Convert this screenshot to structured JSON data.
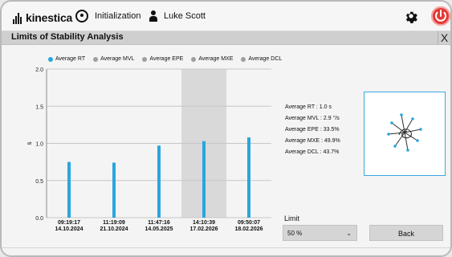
{
  "header": {
    "brand": "kinestica",
    "nav_init_label": "Initialization",
    "user_name": "Luke Scott"
  },
  "panel": {
    "title": "Limits of Stability Analysis",
    "close_glyph": "X"
  },
  "colors": {
    "accent": "#2aa6df",
    "legend_inactive": "#9e9e9e",
    "power": "#e53935"
  },
  "chart_data": {
    "type": "bar",
    "legend": [
      {
        "label": "Average RT",
        "active": true
      },
      {
        "label": "Average MVL",
        "active": false
      },
      {
        "label": "Average EPE",
        "active": false
      },
      {
        "label": "Average MXE",
        "active": false
      },
      {
        "label": "Average DCL",
        "active": false
      }
    ],
    "ylabel": "s",
    "ylim": [
      0,
      2.0
    ],
    "yticks": [
      "0.0",
      "0.5",
      "1.0",
      "1.5",
      "2.0"
    ],
    "categories": [
      [
        "09:19:17",
        "14.10.2024"
      ],
      [
        "11:19:09",
        "21.10.2024"
      ],
      [
        "11:47:16",
        "14.05.2025"
      ],
      [
        "14:10:39",
        "17.02.2026"
      ],
      [
        "09:50:07",
        "18.02.2026"
      ]
    ],
    "values": [
      0.75,
      0.74,
      0.97,
      1.03,
      1.08
    ],
    "highlight_index": 3,
    "grid": true
  },
  "stats": [
    "Average RT : 1.0 s",
    "Average MVL : 2.9 °/s",
    "Average EPE : 33.5%",
    "Average MXE : 49.9%",
    "Average DCL : 43.7%"
  ],
  "controls": {
    "limit_label": "Limit",
    "limit_value": "50 %",
    "back_label": "Back"
  },
  "icons": {
    "gear": "gear-icon",
    "power": "power-icon",
    "init": "initialization-icon",
    "user": "user-icon",
    "close": "close-icon",
    "stability": "stability-trace-icon"
  }
}
